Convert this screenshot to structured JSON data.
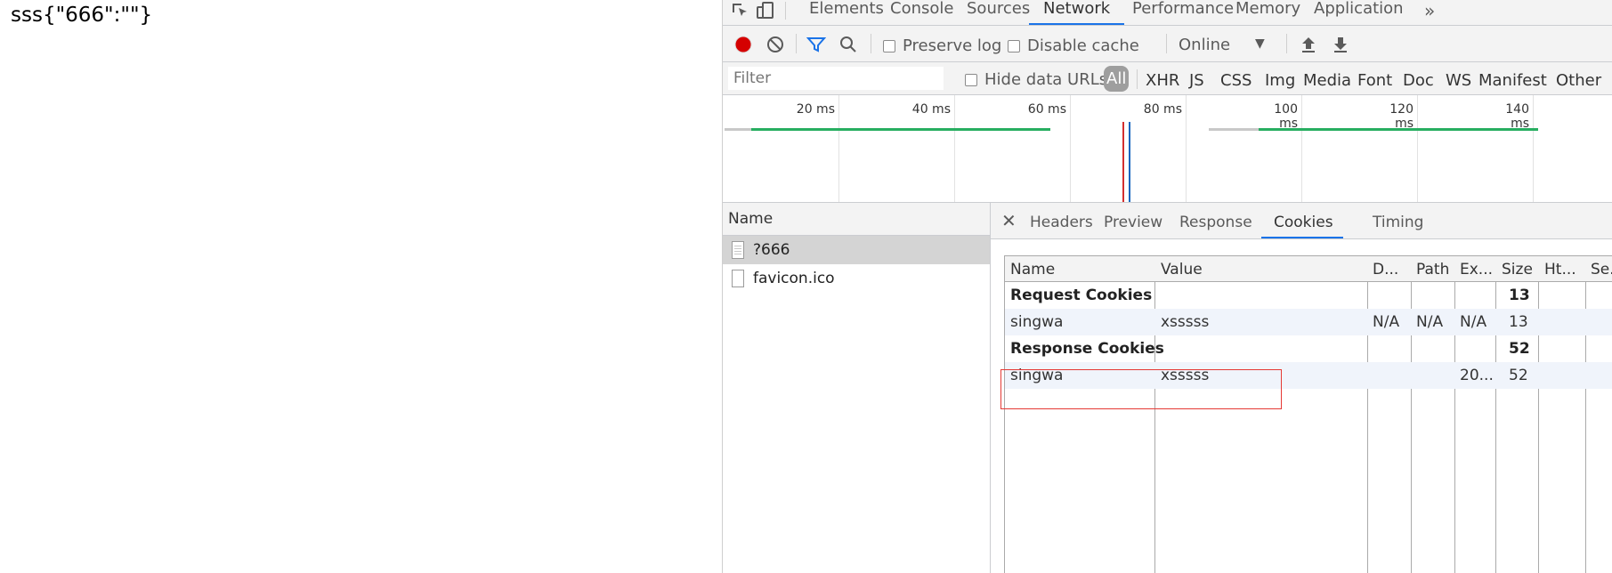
{
  "page": {
    "text": "sss{\"666\":\"\"}"
  },
  "devtools": {
    "tabs": [
      "Elements",
      "Console",
      "Sources",
      "Network",
      "Performance",
      "Memory",
      "Application"
    ],
    "active_tab": "Network",
    "toolbar": {
      "preserve_log": "Preserve log",
      "disable_cache": "Disable cache",
      "throttle": "Online"
    },
    "filter": {
      "placeholder": "Filter",
      "hide_data_urls": "Hide data URLs",
      "types": [
        "All",
        "XHR",
        "JS",
        "CSS",
        "Img",
        "Media",
        "Font",
        "Doc",
        "WS",
        "Manifest",
        "Other"
      ]
    },
    "overview": {
      "ticks": [
        "20 ms",
        "40 ms",
        "60 ms",
        "80 ms",
        "100 ms",
        "120 ms",
        "140 ms"
      ]
    },
    "requests": {
      "header": "Name",
      "items": [
        "?666",
        "favicon.ico"
      ]
    },
    "details": {
      "tabs": [
        "Headers",
        "Preview",
        "Response",
        "Cookies",
        "Timing"
      ],
      "active": "Cookies",
      "columns": [
        "Name",
        "Value",
        "D...",
        "Path",
        "Ex...",
        "Size",
        "Ht...",
        "Se..."
      ],
      "rows": [
        {
          "name": "Request Cookies",
          "value": "",
          "domain": "",
          "path": "",
          "expires": "",
          "size": "13"
        },
        {
          "name": "singwa",
          "value": "xsssss",
          "domain": "N/A",
          "path": "N/A",
          "expires": "N/A",
          "size": "13"
        },
        {
          "name": "Response Cookies",
          "value": "",
          "domain": "",
          "path": "",
          "expires": "",
          "size": "52"
        },
        {
          "name": "singwa",
          "value": "xsssss",
          "domain": "",
          "path": "",
          "expires": "20...",
          "size": "52"
        }
      ]
    }
  },
  "colors": {
    "accent": "#1a73e8",
    "record": "#d50000",
    "highlight": "#e53935",
    "green_bar": "#27ae60"
  }
}
